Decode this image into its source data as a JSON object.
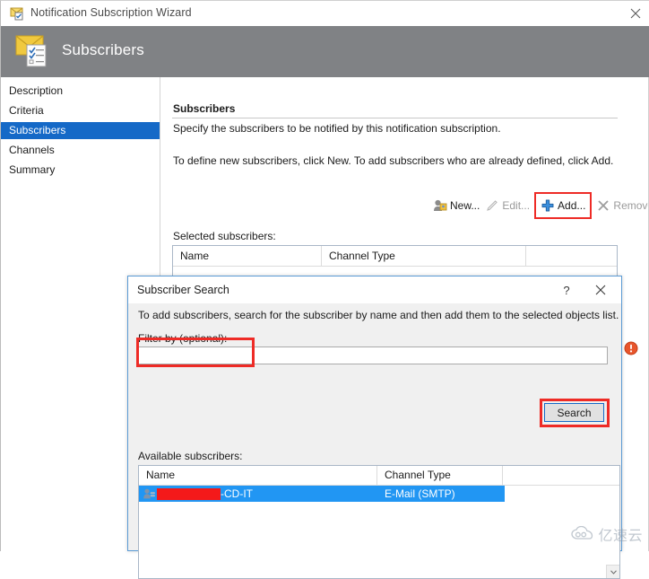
{
  "wizard": {
    "title": "Notification Subscription Wizard",
    "title_icon": "notification-subscription-icon",
    "close_label": "✕",
    "header": {
      "title": "Subscribers",
      "icon": "envelope-document-icon"
    },
    "sidebar": {
      "items": [
        {
          "label": "Description",
          "selected": false
        },
        {
          "label": "Criteria",
          "selected": false
        },
        {
          "label": "Subscribers",
          "selected": true
        },
        {
          "label": "Channels",
          "selected": false
        },
        {
          "label": "Summary",
          "selected": false
        }
      ]
    },
    "content": {
      "section_title": "Subscribers",
      "subtitle": "Specify the subscribers to be notified by this notification subscription.",
      "hint": "To define new subscribers, click New.  To add subscribers who are already defined, click Add.",
      "toolbar": {
        "new_label": "New...",
        "edit_label": "Edit...",
        "add_label": "Add...",
        "remove_label": "Remove...",
        "new_icon": "new-user-icon",
        "edit_icon": "pencil-icon",
        "add_icon": "blue-plus-icon",
        "remove_icon": "gray-x-icon"
      },
      "selected_subscribers_label": "Selected subscribers:",
      "selected_subscribers_columns": [
        "Name",
        "Channel Type"
      ],
      "selected_subscribers_rows": []
    }
  },
  "dialog": {
    "title": "Subscriber Search",
    "help_label": "?",
    "close_label": "✕",
    "instruction": "To add subscribers, search for the subscriber by name and then add them to the selected objects list.",
    "filter_label": "Filter by (optional):",
    "filter_value": "",
    "filter_placeholder": "",
    "search_button_label": "Search",
    "available_subscribers_label": "Available subscribers:",
    "available_columns": [
      "Name",
      "Channel Type"
    ],
    "available_rows": [
      {
        "name": "-CD-IT",
        "name_redacted": true,
        "channel_type": "E-Mail (SMTP)",
        "icon": "subscriber-user-icon",
        "selected": true
      }
    ],
    "scroll_down_glyph": "▼"
  },
  "annotations": {
    "accent_red": "#ee2b26",
    "highlight_blue": "#1569c7",
    "redaction_red": "#f4191a"
  },
  "validation": {
    "warning_icon": "error-warning-icon"
  },
  "watermark": {
    "text": "亿速云",
    "icon": "cloud-logo-icon"
  }
}
